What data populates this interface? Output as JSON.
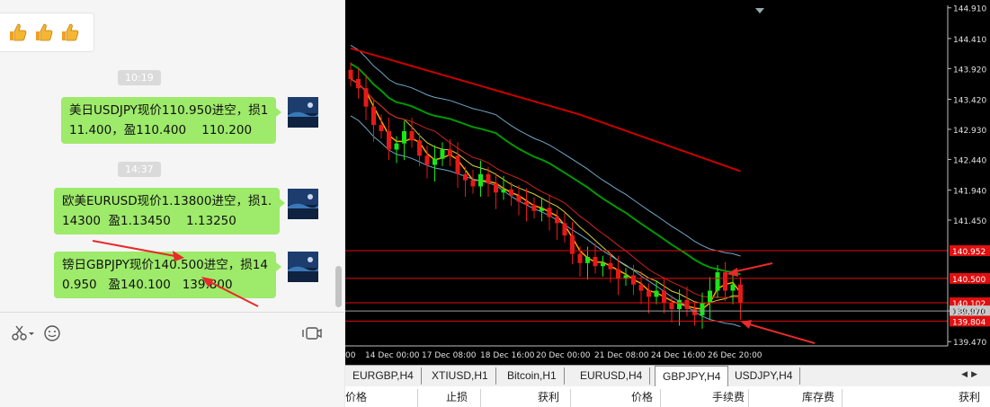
{
  "chat": {
    "emojis": [
      "thumbs-up",
      "thumbs-up",
      "thumbs-up"
    ],
    "messages": [
      {
        "time": "10:19",
        "text_lines": [
          "美日USDJPY现价110.950进空，损1",
          "11.400，盈110.400    110.200"
        ]
      },
      {
        "time": "14:37",
        "text_lines": [
          "欧美EURUSD现价1.13800进空，损1.",
          "14300  盈1.13450    1.13250"
        ]
      },
      {
        "time": "",
        "text_lines": [
          "镑日GBPJPY现价140.500进空，损14",
          "0.950   盈140.100   139.800"
        ]
      }
    ],
    "toolbar_icons": [
      "scissors-icon",
      "emoji-icon",
      "video-call-icon"
    ],
    "bubble_color": "#9eea6a"
  },
  "chart": {
    "symbol_tab_active": "GBPJPY,H4",
    "tabs": [
      "EURGBP,H4",
      "XTIUSD,H1",
      "Bitcoin,H1",
      "EURUSD,H4",
      "GBPJPY,H4",
      "USDJPY,H4"
    ],
    "price_axis": [
      "144.910",
      "144.410",
      "143.920",
      "143.420",
      "142.930",
      "142.440",
      "141.940",
      "141.450",
      "140.952",
      "140.500",
      "140.102",
      "139.970",
      "139.804",
      "139.470"
    ],
    "time_axis": [
      "00",
      "14 Dec 00:00",
      "17 Dec 08:00",
      "18 Dec 16:00",
      "20 Dec 00:00",
      "21 Dec 08:00",
      "24 Dec 16:00",
      "26 Dec 20:00"
    ],
    "price_labels": {
      "stop_loss": "140.952",
      "entry": "140.500",
      "target1": "140.102",
      "bid": "139.970",
      "target2": "139.804"
    },
    "colors": {
      "bull": "#19e619",
      "bear": "#e61919",
      "level": "#ff0000",
      "ma_fast": "#ffa500",
      "ma_slow": "#cc2222",
      "ma_long": "#cc0000",
      "ma_green": "#009900",
      "band": "#6fa8c8"
    }
  },
  "terminal": {
    "columns": [
      "价格",
      "止损",
      "获利",
      "价格",
      "手续费",
      "库存费",
      "获利"
    ]
  },
  "chart_data": {
    "type": "candlestick",
    "ylim": [
      139.4,
      144.95
    ],
    "closes": [
      143.75,
      143.6,
      143.3,
      143.0,
      142.9,
      142.6,
      142.7,
      142.9,
      142.75,
      142.5,
      142.35,
      142.45,
      142.6,
      142.5,
      142.2,
      142.1,
      142.0,
      142.2,
      142.05,
      141.9,
      141.95,
      141.85,
      141.75,
      141.7,
      141.6,
      141.65,
      141.5,
      141.4,
      141.2,
      140.9,
      140.75,
      140.85,
      140.7,
      140.75,
      140.65,
      140.5,
      140.55,
      140.4,
      140.3,
      140.2,
      140.3,
      140.1,
      140.0,
      140.15,
      140.0,
      139.9,
      140.1,
      140.3,
      140.6,
      140.3,
      140.4,
      140.1
    ]
  }
}
